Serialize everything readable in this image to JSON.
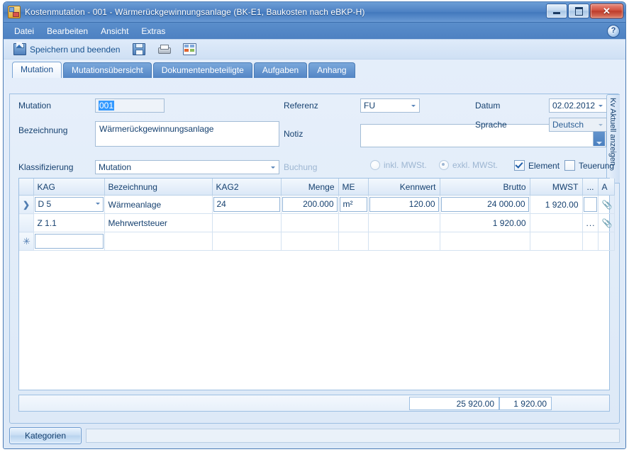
{
  "window": {
    "title": "Kostenmutation - 001 - Wärmerückgewinnungsanlage (BK-E1, Baukosten nach eBKP-H)",
    "icon": "app-icon",
    "buttons": {
      "minimize": "minimize-icon",
      "maximize": "maximize-icon",
      "close": "✕"
    }
  },
  "menu": {
    "items": [
      {
        "label": "Datei"
      },
      {
        "label": "Bearbeiten"
      },
      {
        "label": "Ansicht"
      },
      {
        "label": "Extras"
      }
    ],
    "help": "?"
  },
  "toolbar": {
    "save_and_close_label": "Speichern und beenden",
    "icons": [
      "save-icon",
      "print-icon",
      "report-icon"
    ]
  },
  "tabs": [
    {
      "label": "Mutation",
      "active": true
    },
    {
      "label": "Mutationsübersicht",
      "active": false
    },
    {
      "label": "Dokumentenbeteiligte",
      "active": false
    },
    {
      "label": "Aufgaben",
      "active": false
    },
    {
      "label": "Anhang",
      "active": false
    }
  ],
  "form": {
    "mutation_label": "Mutation",
    "mutation_value": "001",
    "bezeichnung_label": "Bezeichnung",
    "bezeichnung_value": "Wärmerückgewinnungsanlage",
    "klassifizierung_label": "Klassifizierung",
    "klassifizierung_value": "Mutation",
    "referenz_label": "Referenz",
    "referenz_value": "FU",
    "notiz_label": "Notiz",
    "notiz_value": "",
    "buchung_label": "Buchung",
    "radio_inkl_label": "inkl. MWSt.",
    "radio_exkl_label": "exkl. MWSt.",
    "radio_selected": "exkl",
    "datum_label": "Datum",
    "datum_value": "02.02.2012",
    "sprache_label": "Sprache",
    "sprache_value": "Deutsch",
    "element_label": "Element",
    "element_checked": true,
    "teuerung_label": "Teuerung",
    "teuerung_checked": false
  },
  "grid": {
    "columns": [
      {
        "label": "",
        "key": "rowhdr"
      },
      {
        "label": "KAG"
      },
      {
        "label": "Bezeichnung"
      },
      {
        "label": "KAG2"
      },
      {
        "label": "Menge",
        "align": "num"
      },
      {
        "label": "ME"
      },
      {
        "label": "Kennwert",
        "align": "num"
      },
      {
        "label": "Brutto",
        "align": "num"
      },
      {
        "label": "MWST",
        "align": "num"
      },
      {
        "label": "...",
        "align": "num"
      },
      {
        "label": "A"
      }
    ],
    "rows": [
      {
        "marker": "❯",
        "kag": "D 5",
        "bezeichnung": "Wärmeanlage",
        "kag2": "24",
        "menge": "200.000",
        "me": "m²",
        "kennwert": "120.00",
        "brutto": "24 000.00",
        "mwst": "1 920.00",
        "extra": "",
        "attachment": "📎"
      },
      {
        "marker": "",
        "kag": "Z 1.1",
        "bezeichnung": "Mehrwertsteuer",
        "kag2": "",
        "menge": "",
        "me": "",
        "kennwert": "",
        "brutto": "1 920.00",
        "mwst": "",
        "extra": "...",
        "attachment": "📎"
      },
      {
        "marker": "✳",
        "kag": "",
        "bezeichnung": "",
        "kag2": "",
        "menge": "",
        "me": "",
        "kennwert": "",
        "brutto": "",
        "mwst": "",
        "extra": "",
        "attachment": ""
      }
    ]
  },
  "totals": {
    "brutto_total": "25 920.00",
    "mwst_total": "1 920.00"
  },
  "side_panel": {
    "label": "Kv Aktuell anzeigen"
  },
  "bottom": {
    "kategorien_label": "Kategorien",
    "status_text": ""
  },
  "colors": {
    "title_bar": "#4e82c4",
    "accent": "#15406f",
    "selection": "#3399ff",
    "close_button": "#bc3c2b",
    "panel_bg": "#e6effa"
  }
}
